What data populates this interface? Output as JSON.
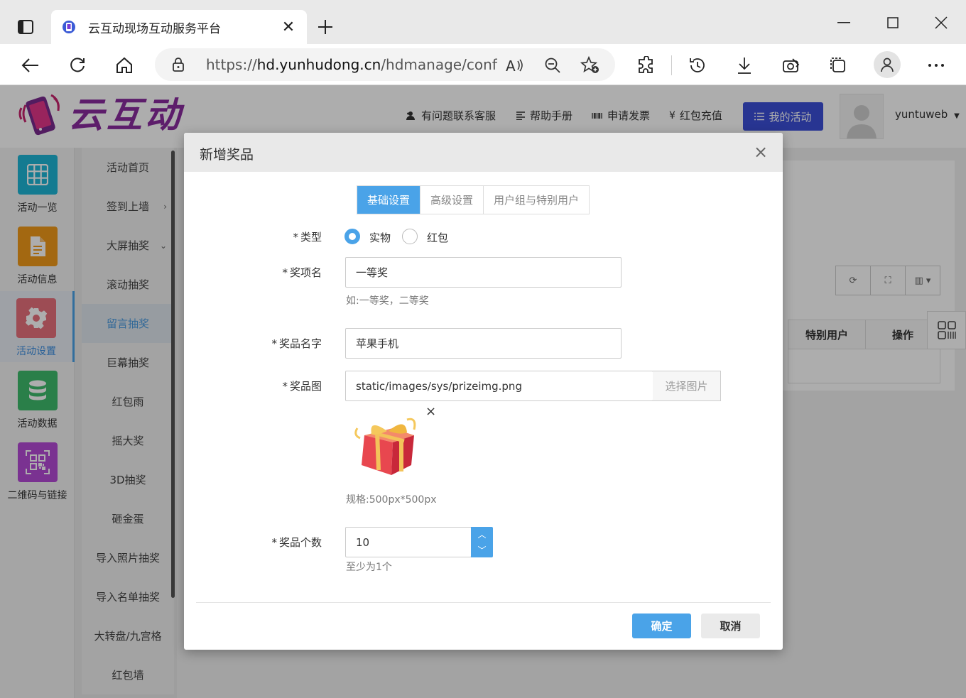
{
  "browser": {
    "tab_title": "云互动现场互动服务平台",
    "url_prefix": "https://",
    "url_host": "hd.yunhudong.cn",
    "url_path": "/hdmanage/confi..."
  },
  "header": {
    "logo_text": "云互动",
    "links": [
      "有问题联系客服",
      "帮助手册",
      "申请发票",
      "红包充值"
    ],
    "my_activity": "我的活动",
    "username": "yuntuweb"
  },
  "leftnav": {
    "items": [
      {
        "label": "活动一览",
        "color": "#1eb6d6"
      },
      {
        "label": "活动信息",
        "color": "#f09a1a"
      },
      {
        "label": "活动设置",
        "color": "#e8707c"
      },
      {
        "label": "活动数据",
        "color": "#3fbb6c"
      },
      {
        "label": "二维码与链接",
        "color": "#b44ad6"
      }
    ]
  },
  "subnav": {
    "items": [
      "活动首页",
      "签到上墙",
      "大屏抽奖",
      "滚动抽奖",
      "留言抽奖",
      "巨幕抽奖",
      "红包雨",
      "摇大奖",
      "3D抽奖",
      "砸金蛋",
      "导入照片抽奖",
      "导入名单抽奖",
      "大转盘/九宫格",
      "红包墙"
    ]
  },
  "table": {
    "headers": [
      "特别用户",
      "操作"
    ]
  },
  "modal": {
    "title": "新增奖品",
    "tabs": [
      "基础设置",
      "高级设置",
      "用户组与特别用户"
    ],
    "type_label": "类型",
    "type_options": [
      "实物",
      "红包"
    ],
    "award_name_label": "奖项名",
    "award_name_value": "一等奖",
    "award_name_hint": "如:一等奖，二等奖",
    "prize_name_label": "奖品名字",
    "prize_name_value": "苹果手机",
    "prize_img_label": "奖品图",
    "prize_img_value": "static/images/sys/prizeimg.png",
    "pick_image": "选择图片",
    "img_spec": "规格:500px*500px",
    "count_label": "奖品个数",
    "count_value": "10",
    "count_hint": "至少为1个",
    "confirm": "确定",
    "cancel": "取消"
  }
}
